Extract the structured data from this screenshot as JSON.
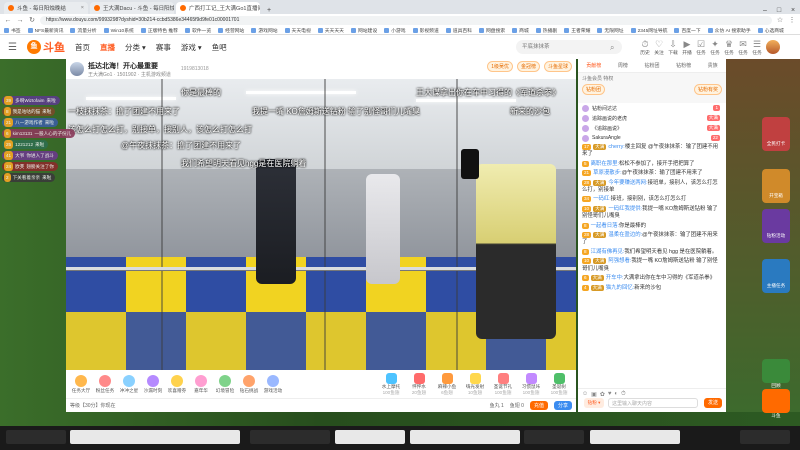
{
  "browser": {
    "tabs": [
      {
        "title": "斗鱼 - 每日阳烛晚结",
        "active": false
      },
      {
        "title": "王大满Dacu - 斗鱼 - 每日阳烛晚结",
        "active": false
      },
      {
        "title": "广西打工记_王大满Go1直播间",
        "active": true
      }
    ],
    "new_tab": "+",
    "url": "https://www.douyu.com/9993298?dyshid=30b214-ccbd5386e34465f9d9fe01c00001701",
    "bookmarks": [
      "书签",
      "NFS最新资讯",
      "流量分析",
      "Win10系统",
      "正版特色 推荐",
      "软件一览",
      "经营网站",
      "游戏网站",
      "天天电视",
      "天天天天",
      "网站建设",
      "小游戏",
      "影视频道",
      "道具百科",
      "网盘搜索",
      "商城",
      "热播剧",
      "王者荣耀",
      "无限网址",
      "2345网址导航",
      "百度一下",
      "众仿 AI 搜索助手",
      "心选商城"
    ]
  },
  "header": {
    "logo_text": "斗鱼",
    "nav": [
      "首页",
      "直播",
      "分类",
      "赛事",
      "游戏",
      "鱼吧"
    ],
    "search_placeholder": "平底抹抹茶",
    "icons": [
      {
        "label": "历史",
        "glyph": "⏱"
      },
      {
        "label": "关注",
        "glyph": "♡"
      },
      {
        "label": "下载",
        "glyph": "⇩"
      },
      {
        "label": "开播",
        "glyph": "▶"
      },
      {
        "label": "任务",
        "glyph": "☑"
      },
      {
        "label": "任务",
        "glyph": "✦"
      },
      {
        "label": "任务",
        "glyph": "♛"
      },
      {
        "label": "任务",
        "glyph": "✉"
      },
      {
        "label": "任务",
        "glyph": "☰"
      }
    ]
  },
  "room": {
    "title": "抵达北海！开心最重要",
    "room_number": "1919813018",
    "streamer": "王大满Go1",
    "viewers": "1501902",
    "category": "主机游戏频道",
    "badge_fans": "1级吴优",
    "badge_rank": "金冠榜",
    "badge_extra": "斗鱼星球"
  },
  "video_danmaku": [
    "你是最棒的",
    "王大谋拿出你在车中习得的《军道杀拳》",
    "一枝抹抹茶：撸了团建不用来了",
    "我提一嘴 KO詹姆斯送钻粉 输了别怪哥们儿嘴臭",
    "新来的沙包",
    "该怎么打怎么打，别接单，接别人，该怎么打怎么打",
    "@午夜抹抹茶：撸了团建不用来了",
    "我们希望明天看见hgg是在医院躺着"
  ],
  "left_overlay": [
    {
      "lv": "39",
      "user": "多啊Wiztofaim",
      "text": "来啦"
    },
    {
      "lv": "8",
      "user": "我是咕咕的猫",
      "text": "来啦"
    },
    {
      "lv": "21",
      "user": "八一游戏作者",
      "text": "来啦"
    },
    {
      "lv": "6",
      "user": "kim13131",
      "text": "一股人心的子份儿"
    },
    {
      "lv": "25",
      "user": "1221212",
      "text": "来啦"
    },
    {
      "lv": "41",
      "user": "大爷",
      "text": "你进入了战斗"
    },
    {
      "lv": "24",
      "user": "欧芙",
      "text": "翅膀关注了你"
    },
    {
      "lv": "2",
      "user": "下关看着亲亲",
      "text": "来啦"
    }
  ],
  "toolbar": {
    "tools": [
      "任务大厅",
      "粉丝任务",
      "冲冲之星",
      "沙漏时刻",
      "欢喜赠券",
      "嘉年华",
      "幻境冒险",
      "钻石挑战",
      "游戏活动"
    ],
    "gifts": [
      "水上摩托",
      "怦怦水",
      "麻辣小鱼",
      "嗨光发射",
      "圣诞节礼",
      "习惯鼠咔",
      "圣诞树"
    ],
    "gift_prices": [
      "100鱼翅",
      "20鱼翅",
      "6鱼翅",
      "10鱼翅",
      "100鱼翅",
      "100鱼翅",
      "100鱼翅"
    ]
  },
  "bottom_bar": {
    "level_text": "等级【30分】你现在",
    "coins": "鱼丸 1",
    "shells": "鱼翅 0",
    "recharge": "充值",
    "pay": "分享"
  },
  "chat": {
    "tabs": [
      "贡献榜",
      "周榜",
      "钻粉团",
      "钻粉榜",
      "贵族"
    ],
    "vip_title": "斗鱼会员 特权",
    "vip_items": [
      "钻粉团",
      "钻粉有奖"
    ],
    "fans": [
      {
        "name": "钻粉间达达",
        "tag": "1"
      },
      {
        "name": "追踪画说的老虎",
        "tag": "大满"
      },
      {
        "name": "《追踪画说》",
        "tag": "大满"
      },
      {
        "name": "SakuraAngle",
        "tag": "22"
      }
    ],
    "messages": [
      {
        "badges": [
          "17",
          "大满"
        ],
        "user": "cherry:",
        "text": "楼主回复 @午夜抹抹茶：输了团建不用来了"
      },
      {
        "badges": [
          "5"
        ],
        "user": "离职在那里:",
        "text": "松松不参加了，接开手把把算了"
      },
      {
        "badges": [
          "21"
        ],
        "user": "草原漫散步:",
        "text": "@午夜抹抹茶：输了团建不用来了"
      },
      {
        "badges": [
          "28",
          "大满"
        ],
        "user": "今年要赚送两网:",
        "text": "接班单，接别人，该怎么打怎么打，别接单"
      },
      {
        "badges": [
          "34"
        ],
        "user": "一码红:",
        "text": "接班，接别别，该怎么打怎么打"
      },
      {
        "badges": [
          "10",
          "大满"
        ],
        "user": "一码红我提供:",
        "text": "我提一嘴 KO詹姆斯送钻粉 输了别怪哥们儿嘴臭"
      },
      {
        "badges": [
          "8"
        ],
        "user": "一起看日落:",
        "text": "你是最棒的"
      },
      {
        "badges": [
          "28",
          "大满"
        ],
        "user": "温柔在盈边的:",
        "text": "@午夜抹抹茶：输了团建不用来了"
      },
      {
        "badges": [
          "8"
        ],
        "user": "江湖有佛再见:",
        "text": "我们希望明天看见 hgg 是在医院躺着。"
      },
      {
        "badges": [
          "10",
          "大满"
        ],
        "user": "阿强想看:",
        "text": "我提一嘴 KO詹姆斯送钻粉 输了别怪哥们儿嘴臭"
      },
      {
        "badges": [
          "6",
          "大满"
        ],
        "user": "开车中:",
        "text": "大满拿出你在车中习得的《军道杀拳》"
      },
      {
        "badges": [
          "4",
          "大满"
        ],
        "user": "猫九的回忆:",
        "text": "新来的沙包"
      }
    ],
    "input_placeholder": "这里输入聊天内容",
    "send": "发送",
    "tag_btn": "钻粉 ▾"
  },
  "sidebar_right": {
    "cards": [
      "全民打卡",
      "开宝箱",
      "钻粉活动",
      "主播任务",
      "回顾",
      "斗鱼"
    ]
  },
  "colors": {
    "accent": "#ff5d23",
    "douyu_orange": "#ff7a00",
    "link_blue": "#3b8cf0"
  }
}
